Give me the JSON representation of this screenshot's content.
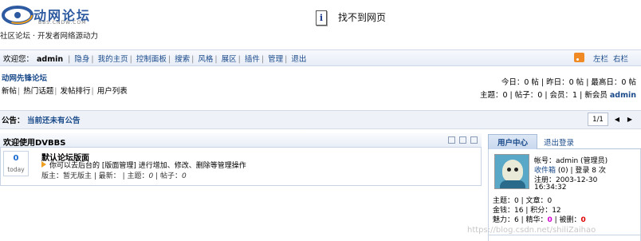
{
  "header": {
    "logo_title": "动网论坛",
    "logo_sub": "BBS.CNDW.COM",
    "slogan": "社区论坛 · 开发者网络源动力",
    "error_text": "找不到网页"
  },
  "toolbar": {
    "welcome": "欢迎您：",
    "username": "admin",
    "items": [
      "隐身",
      "我的主页",
      "控制面板",
      "搜索",
      "风格",
      "展区",
      "插件",
      "管理",
      "退出"
    ],
    "layout_left": "左栏",
    "layout_right": "右栏"
  },
  "forum": {
    "name": "动网先锋论坛",
    "links": [
      "新帖",
      "热门话题",
      "发帖排行",
      "用户列表"
    ],
    "stats1": "今日：0 帖 | 昨日：0 帖 | 最高日：0 帖",
    "stats2_prefix": "主题：0 | 帖子：0 | 会员：1 | 新会员",
    "stats2_member": "admin"
  },
  "announcement": {
    "label": "公告：",
    "text": "当前还未有公告",
    "pager": "1/1",
    "prev": "◀",
    "next": "▶"
  },
  "panel": {
    "title": "欢迎使用DVBBS",
    "today_count": "0",
    "today_label": "today",
    "board_name": "默认论坛版面",
    "board_desc": "你可以去后台的 [版面管理] 进行增加、修改、删除等管理操作",
    "board_meta_prefix": "版主：暂无版主 | 最新：  | 主题：",
    "board_meta_topics": "0",
    "board_meta_posts_label": " | 帖子：",
    "board_meta_posts": "0"
  },
  "user_center": {
    "tab_active": "用户中心",
    "tab_logout": "退出登录",
    "line1": "帐号：admin (管理员)",
    "inbox_label": "收件箱",
    "inbox_count": "(0)",
    "logins": "| 登录 8 次",
    "registered": "注册：2003-12-30",
    "registered_time": "16:34:32",
    "stat1": "主题：0 | 文章：0",
    "stat2": "金钱：16 | 积分：12",
    "stat3_a": "魅力：6 | 精华：",
    "stat3_elite": "0",
    "stat3_b": " | 被删：",
    "stat3_deleted": "0"
  },
  "watermark": "https://blog.csdn.net/shiliZaihao"
}
